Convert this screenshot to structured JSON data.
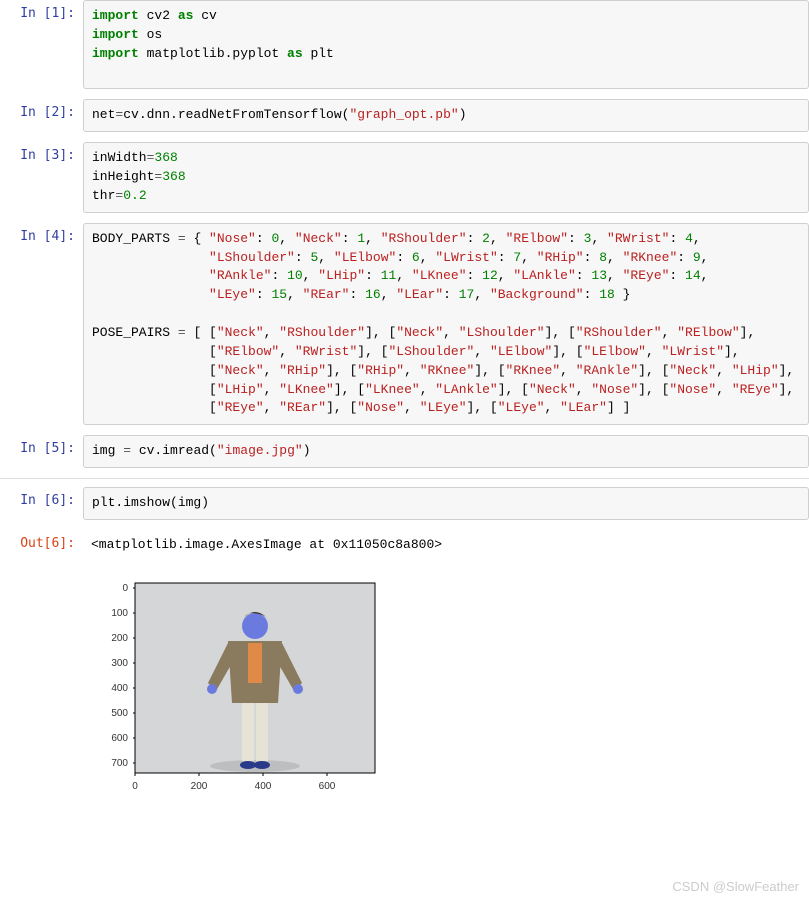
{
  "cells": {
    "c1": {
      "prompt": "In  [1]:",
      "tokens": [
        {
          "t": "import",
          "c": "imp"
        },
        {
          "t": " cv2 ",
          "c": "mod"
        },
        {
          "t": "as",
          "c": "as"
        },
        {
          "t": " cv",
          "c": "mod"
        },
        {
          "t": "\n"
        },
        {
          "t": "import",
          "c": "imp"
        },
        {
          "t": " os",
          "c": "mod"
        },
        {
          "t": "\n"
        },
        {
          "t": "import",
          "c": "imp"
        },
        {
          "t": " matplotlib.pyplot ",
          "c": "mod"
        },
        {
          "t": "as",
          "c": "as"
        },
        {
          "t": " plt",
          "c": "mod"
        },
        {
          "t": "\n"
        },
        {
          "t": "\n"
        }
      ]
    },
    "c2": {
      "prompt": "In  [2]:",
      "tokens": [
        {
          "t": "net",
          "c": "nm"
        },
        {
          "t": "=",
          "c": "eq"
        },
        {
          "t": "cv.dnn.readNetFromTensorflow(",
          "c": "nm"
        },
        {
          "t": "\"graph_opt.pb\"",
          "c": "str"
        },
        {
          "t": ")",
          "c": "nm"
        }
      ]
    },
    "c3": {
      "prompt": "In  [3]:",
      "tokens": [
        {
          "t": "inWidth",
          "c": "nm"
        },
        {
          "t": "=",
          "c": "eq"
        },
        {
          "t": "368",
          "c": "num"
        },
        {
          "t": "\n"
        },
        {
          "t": "inHeight",
          "c": "nm"
        },
        {
          "t": "=",
          "c": "eq"
        },
        {
          "t": "368",
          "c": "num"
        },
        {
          "t": "\n"
        },
        {
          "t": "thr",
          "c": "nm"
        },
        {
          "t": "=",
          "c": "eq"
        },
        {
          "t": "0.2",
          "c": "num"
        }
      ]
    },
    "c4": {
      "prompt": "In  [4]:",
      "tokens": [
        {
          "t": "BODY_PARTS ",
          "c": "nm"
        },
        {
          "t": "=",
          "c": "eq"
        },
        {
          "t": " { ",
          "c": "punct"
        },
        {
          "t": "\"Nose\"",
          "c": "str"
        },
        {
          "t": ": ",
          "c": "punct"
        },
        {
          "t": "0",
          "c": "num"
        },
        {
          "t": ", ",
          "c": "punct"
        },
        {
          "t": "\"Neck\"",
          "c": "str"
        },
        {
          "t": ": ",
          "c": "punct"
        },
        {
          "t": "1",
          "c": "num"
        },
        {
          "t": ", ",
          "c": "punct"
        },
        {
          "t": "\"RShoulder\"",
          "c": "str"
        },
        {
          "t": ": ",
          "c": "punct"
        },
        {
          "t": "2",
          "c": "num"
        },
        {
          "t": ", ",
          "c": "punct"
        },
        {
          "t": "\"RElbow\"",
          "c": "str"
        },
        {
          "t": ": ",
          "c": "punct"
        },
        {
          "t": "3",
          "c": "num"
        },
        {
          "t": ", ",
          "c": "punct"
        },
        {
          "t": "\"RWrist\"",
          "c": "str"
        },
        {
          "t": ": ",
          "c": "punct"
        },
        {
          "t": "4",
          "c": "num"
        },
        {
          "t": ",",
          "c": "punct"
        },
        {
          "t": "\n"
        },
        {
          "t": "               ",
          "c": "nm"
        },
        {
          "t": "\"LShoulder\"",
          "c": "str"
        },
        {
          "t": ": ",
          "c": "punct"
        },
        {
          "t": "5",
          "c": "num"
        },
        {
          "t": ", ",
          "c": "punct"
        },
        {
          "t": "\"LElbow\"",
          "c": "str"
        },
        {
          "t": ": ",
          "c": "punct"
        },
        {
          "t": "6",
          "c": "num"
        },
        {
          "t": ", ",
          "c": "punct"
        },
        {
          "t": "\"LWrist\"",
          "c": "str"
        },
        {
          "t": ": ",
          "c": "punct"
        },
        {
          "t": "7",
          "c": "num"
        },
        {
          "t": ", ",
          "c": "punct"
        },
        {
          "t": "\"RHip\"",
          "c": "str"
        },
        {
          "t": ": ",
          "c": "punct"
        },
        {
          "t": "8",
          "c": "num"
        },
        {
          "t": ", ",
          "c": "punct"
        },
        {
          "t": "\"RKnee\"",
          "c": "str"
        },
        {
          "t": ": ",
          "c": "punct"
        },
        {
          "t": "9",
          "c": "num"
        },
        {
          "t": ",",
          "c": "punct"
        },
        {
          "t": "\n"
        },
        {
          "t": "               ",
          "c": "nm"
        },
        {
          "t": "\"RAnkle\"",
          "c": "str"
        },
        {
          "t": ": ",
          "c": "punct"
        },
        {
          "t": "10",
          "c": "num"
        },
        {
          "t": ", ",
          "c": "punct"
        },
        {
          "t": "\"LHip\"",
          "c": "str"
        },
        {
          "t": ": ",
          "c": "punct"
        },
        {
          "t": "11",
          "c": "num"
        },
        {
          "t": ", ",
          "c": "punct"
        },
        {
          "t": "\"LKnee\"",
          "c": "str"
        },
        {
          "t": ": ",
          "c": "punct"
        },
        {
          "t": "12",
          "c": "num"
        },
        {
          "t": ", ",
          "c": "punct"
        },
        {
          "t": "\"LAnkle\"",
          "c": "str"
        },
        {
          "t": ": ",
          "c": "punct"
        },
        {
          "t": "13",
          "c": "num"
        },
        {
          "t": ", ",
          "c": "punct"
        },
        {
          "t": "\"REye\"",
          "c": "str"
        },
        {
          "t": ": ",
          "c": "punct"
        },
        {
          "t": "14",
          "c": "num"
        },
        {
          "t": ",",
          "c": "punct"
        },
        {
          "t": "\n"
        },
        {
          "t": "               ",
          "c": "nm"
        },
        {
          "t": "\"LEye\"",
          "c": "str"
        },
        {
          "t": ": ",
          "c": "punct"
        },
        {
          "t": "15",
          "c": "num"
        },
        {
          "t": ", ",
          "c": "punct"
        },
        {
          "t": "\"REar\"",
          "c": "str"
        },
        {
          "t": ": ",
          "c": "punct"
        },
        {
          "t": "16",
          "c": "num"
        },
        {
          "t": ", ",
          "c": "punct"
        },
        {
          "t": "\"LEar\"",
          "c": "str"
        },
        {
          "t": ": ",
          "c": "punct"
        },
        {
          "t": "17",
          "c": "num"
        },
        {
          "t": ", ",
          "c": "punct"
        },
        {
          "t": "\"Background\"",
          "c": "str"
        },
        {
          "t": ": ",
          "c": "punct"
        },
        {
          "t": "18",
          "c": "num"
        },
        {
          "t": " }",
          "c": "punct"
        },
        {
          "t": "\n"
        },
        {
          "t": "\n"
        },
        {
          "t": "POSE_PAIRS ",
          "c": "nm"
        },
        {
          "t": "=",
          "c": "eq"
        },
        {
          "t": " [ [",
          "c": "punct"
        },
        {
          "t": "\"Neck\"",
          "c": "str"
        },
        {
          "t": ", ",
          "c": "punct"
        },
        {
          "t": "\"RShoulder\"",
          "c": "str"
        },
        {
          "t": "], [",
          "c": "punct"
        },
        {
          "t": "\"Neck\"",
          "c": "str"
        },
        {
          "t": ", ",
          "c": "punct"
        },
        {
          "t": "\"LShoulder\"",
          "c": "str"
        },
        {
          "t": "], [",
          "c": "punct"
        },
        {
          "t": "\"RShoulder\"",
          "c": "str"
        },
        {
          "t": ", ",
          "c": "punct"
        },
        {
          "t": "\"RElbow\"",
          "c": "str"
        },
        {
          "t": "],",
          "c": "punct"
        },
        {
          "t": "\n"
        },
        {
          "t": "               [",
          "c": "punct"
        },
        {
          "t": "\"RElbow\"",
          "c": "str"
        },
        {
          "t": ", ",
          "c": "punct"
        },
        {
          "t": "\"RWrist\"",
          "c": "str"
        },
        {
          "t": "], [",
          "c": "punct"
        },
        {
          "t": "\"LShoulder\"",
          "c": "str"
        },
        {
          "t": ", ",
          "c": "punct"
        },
        {
          "t": "\"LElbow\"",
          "c": "str"
        },
        {
          "t": "], [",
          "c": "punct"
        },
        {
          "t": "\"LElbow\"",
          "c": "str"
        },
        {
          "t": ", ",
          "c": "punct"
        },
        {
          "t": "\"LWrist\"",
          "c": "str"
        },
        {
          "t": "],",
          "c": "punct"
        },
        {
          "t": "\n"
        },
        {
          "t": "               [",
          "c": "punct"
        },
        {
          "t": "\"Neck\"",
          "c": "str"
        },
        {
          "t": ", ",
          "c": "punct"
        },
        {
          "t": "\"RHip\"",
          "c": "str"
        },
        {
          "t": "], [",
          "c": "punct"
        },
        {
          "t": "\"RHip\"",
          "c": "str"
        },
        {
          "t": ", ",
          "c": "punct"
        },
        {
          "t": "\"RKnee\"",
          "c": "str"
        },
        {
          "t": "], [",
          "c": "punct"
        },
        {
          "t": "\"RKnee\"",
          "c": "str"
        },
        {
          "t": ", ",
          "c": "punct"
        },
        {
          "t": "\"RAnkle\"",
          "c": "str"
        },
        {
          "t": "], [",
          "c": "punct"
        },
        {
          "t": "\"Neck\"",
          "c": "str"
        },
        {
          "t": ", ",
          "c": "punct"
        },
        {
          "t": "\"LHip\"",
          "c": "str"
        },
        {
          "t": "],",
          "c": "punct"
        },
        {
          "t": "\n"
        },
        {
          "t": "               [",
          "c": "punct"
        },
        {
          "t": "\"LHip\"",
          "c": "str"
        },
        {
          "t": ", ",
          "c": "punct"
        },
        {
          "t": "\"LKnee\"",
          "c": "str"
        },
        {
          "t": "], [",
          "c": "punct"
        },
        {
          "t": "\"LKnee\"",
          "c": "str"
        },
        {
          "t": ", ",
          "c": "punct"
        },
        {
          "t": "\"LAnkle\"",
          "c": "str"
        },
        {
          "t": "], [",
          "c": "punct"
        },
        {
          "t": "\"Neck\"",
          "c": "str"
        },
        {
          "t": ", ",
          "c": "punct"
        },
        {
          "t": "\"Nose\"",
          "c": "str"
        },
        {
          "t": "], [",
          "c": "punct"
        },
        {
          "t": "\"Nose\"",
          "c": "str"
        },
        {
          "t": ", ",
          "c": "punct"
        },
        {
          "t": "\"REye\"",
          "c": "str"
        },
        {
          "t": "],",
          "c": "punct"
        },
        {
          "t": "\n"
        },
        {
          "t": "               [",
          "c": "punct"
        },
        {
          "t": "\"REye\"",
          "c": "str"
        },
        {
          "t": ", ",
          "c": "punct"
        },
        {
          "t": "\"REar\"",
          "c": "str"
        },
        {
          "t": "], [",
          "c": "punct"
        },
        {
          "t": "\"Nose\"",
          "c": "str"
        },
        {
          "t": ", ",
          "c": "punct"
        },
        {
          "t": "\"LEye\"",
          "c": "str"
        },
        {
          "t": "], [",
          "c": "punct"
        },
        {
          "t": "\"LEye\"",
          "c": "str"
        },
        {
          "t": ", ",
          "c": "punct"
        },
        {
          "t": "\"LEar\"",
          "c": "str"
        },
        {
          "t": "] ]",
          "c": "punct"
        }
      ]
    },
    "c5": {
      "prompt": "In  [5]:",
      "tokens": [
        {
          "t": "img ",
          "c": "nm"
        },
        {
          "t": "=",
          "c": "eq"
        },
        {
          "t": " cv.imread(",
          "c": "nm"
        },
        {
          "t": "\"image.jpg\"",
          "c": "str"
        },
        {
          "t": ")",
          "c": "nm"
        }
      ]
    },
    "c6": {
      "prompt": "In  [6]:",
      "tokens": [
        {
          "t": "plt.imshow(img)",
          "c": "nm"
        }
      ]
    },
    "o6": {
      "prompt": "Out[6]:",
      "text": "<matplotlib.image.AxesImage at 0x11050c8a800>"
    }
  },
  "plot": {
    "y_ticks": [
      "0",
      "100",
      "200",
      "300",
      "400",
      "500",
      "600",
      "700"
    ],
    "x_ticks": [
      "0",
      "200",
      "400",
      "600"
    ]
  },
  "watermark": "CSDN @SlowFeather"
}
